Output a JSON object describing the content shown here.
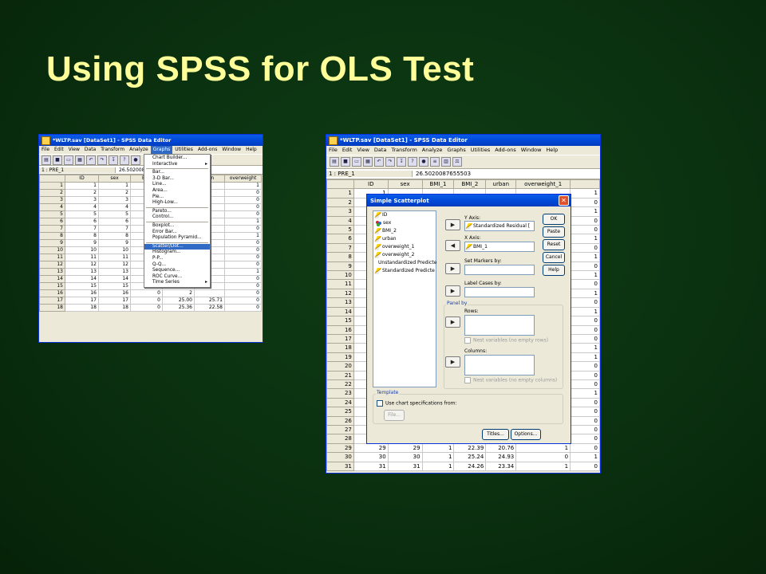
{
  "slide": {
    "title": "Using SPSS for OLS Test"
  },
  "left_window": {
    "title": "*WLTP.sav [DataSet1] - SPSS Data Editor",
    "menus": [
      "File",
      "Edit",
      "View",
      "Data",
      "Transform",
      "Analyze",
      "Graphs",
      "Utilities",
      "Add-ons",
      "Window",
      "Help"
    ],
    "active_menu": "Graphs",
    "cell_ref": "1 : PRE_1",
    "cell_value": "26.502008",
    "columns": [
      "ID",
      "sex",
      "BMI",
      "",
      "ban",
      "overweight"
    ],
    "rows": [
      [
        "1",
        "1",
        "1",
        "2",
        "",
        "1"
      ],
      [
        "2",
        "2",
        "0",
        "2",
        "",
        "0"
      ],
      [
        "3",
        "3",
        "0",
        "2",
        "",
        "0"
      ],
      [
        "4",
        "4",
        "1",
        "2",
        "",
        "0"
      ],
      [
        "5",
        "5",
        "0",
        "2",
        "",
        "0"
      ],
      [
        "6",
        "6",
        "1",
        "2",
        "",
        "1"
      ],
      [
        "7",
        "7",
        "1",
        "2",
        "",
        "0"
      ],
      [
        "8",
        "8",
        "1",
        "2",
        "",
        "1"
      ],
      [
        "9",
        "9",
        "1",
        "2",
        "",
        "0"
      ],
      [
        "10",
        "10",
        "0",
        "2",
        "",
        "0"
      ],
      [
        "11",
        "11",
        "0",
        "2",
        "",
        "0"
      ],
      [
        "12",
        "12",
        "1",
        "2",
        "",
        "0"
      ],
      [
        "13",
        "13",
        "0",
        "2",
        "",
        "1"
      ],
      [
        "14",
        "14",
        "1",
        "2",
        "",
        "0"
      ],
      [
        "15",
        "15",
        "1",
        "2",
        "",
        "0"
      ],
      [
        "16",
        "16",
        "0",
        "2",
        "",
        "0"
      ],
      [
        "17",
        "17",
        "0",
        "25.00",
        "25.71",
        "0"
      ],
      [
        "18",
        "18",
        "0",
        "25.36",
        "22.58",
        "0"
      ]
    ],
    "graphs_menu": [
      {
        "label": "Chart Builder...",
        "submenu": false
      },
      {
        "label": "Interactive",
        "submenu": true
      },
      {
        "sep": true
      },
      {
        "label": "Bar...",
        "submenu": false
      },
      {
        "label": "3-D Bar...",
        "submenu": false
      },
      {
        "label": "Line...",
        "submenu": false
      },
      {
        "label": "Area...",
        "submenu": false
      },
      {
        "label": "Pie...",
        "submenu": false
      },
      {
        "label": "High-Low...",
        "submenu": false
      },
      {
        "sep": true
      },
      {
        "label": "Pareto...",
        "submenu": false
      },
      {
        "label": "Control...",
        "submenu": false
      },
      {
        "sep": true
      },
      {
        "label": "Boxplot...",
        "submenu": false
      },
      {
        "label": "Error Bar...",
        "submenu": false
      },
      {
        "label": "Population Pyramid...",
        "submenu": false
      },
      {
        "sep": true
      },
      {
        "label": "Scatter/Dot...",
        "submenu": false,
        "selected": true
      },
      {
        "label": "Histogram...",
        "submenu": false
      },
      {
        "label": "P-P...",
        "submenu": false
      },
      {
        "label": "Q-Q...",
        "submenu": false
      },
      {
        "label": "Sequence...",
        "submenu": false
      },
      {
        "label": "ROC Curve...",
        "submenu": false
      },
      {
        "label": "Time Series",
        "submenu": true
      }
    ]
  },
  "right_window": {
    "title": "*WLTP.sav [DataSet1] - SPSS Data Editor",
    "menus": [
      "File",
      "Edit",
      "View",
      "Data",
      "Transform",
      "Analyze",
      "Graphs",
      "Utilities",
      "Add-ons",
      "Window",
      "Help"
    ],
    "cell_ref": "1 : PRE_1",
    "cell_value": "26.5020087655503",
    "columns": [
      "ID",
      "sex",
      "BMI_1",
      "BMI_2",
      "urban",
      "overweight_1",
      ""
    ],
    "rows": [
      [
        "1",
        "",
        "",
        "",
        "",
        "",
        "1"
      ],
      [
        "2",
        "",
        "",
        "",
        "",
        "",
        "0"
      ],
      [
        "3",
        "",
        "",
        "",
        "",
        "",
        "1"
      ],
      [
        "4",
        "",
        "",
        "",
        "",
        "",
        "0"
      ],
      [
        "5",
        "",
        "",
        "",
        "",
        "",
        "0"
      ],
      [
        "6",
        "",
        "",
        "",
        "",
        "",
        "1"
      ],
      [
        "7",
        "",
        "",
        "",
        "",
        "",
        "0"
      ],
      [
        "8",
        "",
        "",
        "",
        "",
        "",
        "1"
      ],
      [
        "9",
        "",
        "",
        "",
        "",
        "",
        "0"
      ],
      [
        "10",
        "",
        "",
        "",
        "",
        "",
        "1"
      ],
      [
        "11",
        "",
        "",
        "",
        "",
        "",
        "0"
      ],
      [
        "12",
        "",
        "",
        "",
        "",
        "",
        "1"
      ],
      [
        "13",
        "",
        "",
        "",
        "",
        "",
        "0"
      ],
      [
        "14",
        "",
        "",
        "",
        "",
        "",
        "1"
      ],
      [
        "15",
        "",
        "",
        "",
        "",
        "",
        "0"
      ],
      [
        "16",
        "",
        "",
        "",
        "",
        "",
        "0"
      ],
      [
        "17",
        "",
        "",
        "",
        "",
        "",
        "0"
      ],
      [
        "18",
        "",
        "",
        "",
        "",
        "",
        "1"
      ],
      [
        "19",
        "",
        "",
        "",
        "",
        "",
        "1"
      ],
      [
        "20",
        "",
        "",
        "",
        "",
        "",
        "0"
      ],
      [
        "21",
        "",
        "",
        "",
        "",
        "",
        "0"
      ],
      [
        "22",
        "",
        "",
        "",
        "",
        "",
        "0"
      ],
      [
        "23",
        "",
        "",
        "",
        "",
        "",
        "1"
      ],
      [
        "24",
        "",
        "",
        "",
        "",
        "",
        "0"
      ],
      [
        "25",
        "",
        "",
        "",
        "",
        "",
        "0"
      ],
      [
        "26",
        "",
        "",
        "",
        "",
        "",
        "0"
      ],
      [
        "27",
        "",
        "",
        "",
        "",
        "",
        "0"
      ],
      [
        "28",
        "28",
        "0",
        "23.92",
        "22.07",
        "1",
        "0"
      ],
      [
        "29",
        "29",
        "1",
        "22.39",
        "20.76",
        "1",
        "0"
      ],
      [
        "30",
        "30",
        "1",
        "25.24",
        "24.93",
        "0",
        "1"
      ],
      [
        "31",
        "31",
        "1",
        "24.26",
        "23.34",
        "1",
        "0"
      ]
    ]
  },
  "dialog": {
    "title": "Simple Scatterplot",
    "variables": [
      {
        "name": "ID",
        "icon": "pencil"
      },
      {
        "name": "sex",
        "icon": "nominal"
      },
      {
        "name": "BMI_2",
        "icon": "pencil"
      },
      {
        "name": "urban",
        "icon": "pencil"
      },
      {
        "name": "overweight_1",
        "icon": "pencil"
      },
      {
        "name": "overweight_2",
        "icon": "pencil"
      },
      {
        "name": "Unstandardized Predicte",
        "icon": "pencil"
      },
      {
        "name": "Standardized Predicte",
        "icon": "pencil"
      }
    ],
    "y_axis_label": "Y Axis:",
    "y_axis_value": "Standardized Residual [",
    "x_axis_label": "X Axis:",
    "x_axis_value": "BMI_1",
    "set_markers_label": "Set Markers by:",
    "label_cases_label": "Label Cases by:",
    "panel_by_label": "Panel by",
    "rows_label": "Rows:",
    "nest_rows_label": "Nest variables (no empty rows)",
    "columns_label": "Columns:",
    "nest_columns_label": "Nest variables (no empty columns)",
    "template_label": "Template",
    "use_chart_spec_label": "Use chart specifications from:",
    "file_button": "File...",
    "buttons": {
      "ok": "OK",
      "paste": "Paste",
      "reset": "Reset",
      "cancel": "Cancel",
      "help": "Help",
      "titles": "Titles...",
      "options": "Options..."
    }
  },
  "colors": {
    "title_text": "#ffff99",
    "background": "#0a3010",
    "xp_titlebar": "#0046d5",
    "menu_highlight": "#316ac5"
  }
}
